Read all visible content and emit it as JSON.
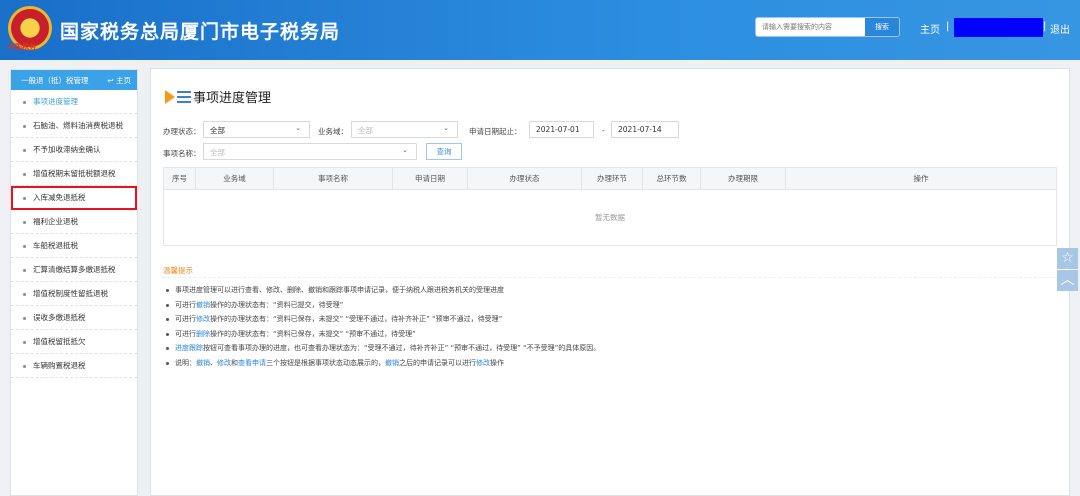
{
  "header": {
    "title": "国家税务总局厦门市电子税务局",
    "emblem_text": "中国税务",
    "search_placeholder": "请输入需要搜索的内容",
    "search_button": "搜索",
    "home": "主页",
    "separator": "|",
    "logout": "退出"
  },
  "sidebar": {
    "title": "一般退（抵）税管理",
    "home": "主页",
    "items": [
      "事项进度管理",
      "石脑油、燃料油消费税退税",
      "不予加收滞纳金确认",
      "增值税期末留抵税额退税",
      "入库减免退抵税",
      "福利企业退税",
      "车船税退抵税",
      "汇算清缴结算多缴退抵税",
      "增值税制度性留抵退税",
      "误收多缴退抵税",
      "增值税留抵抵欠",
      "车辆购置税退税"
    ]
  },
  "main": {
    "title": "事项进度管理",
    "filters": {
      "status_label": "办理状态：",
      "status_value": "全部",
      "domain_label": "业务域：",
      "domain_placeholder": "全部",
      "date_label": "申请日期起止：",
      "date_from": "2021-07-01",
      "date_sep": "-",
      "date_to": "2021-07-14",
      "item_label": "事项名称：",
      "item_placeholder": "全部",
      "query": "查询"
    },
    "table": {
      "headers": [
        "序号",
        "业务域",
        "事项名称",
        "申请日期",
        "办理状态",
        "办理环节",
        "总环节数",
        "办理期限",
        "操作"
      ],
      "empty": "暂无数据"
    },
    "tips": {
      "title": "温馨提示",
      "lines": [
        [
          [
            "事项进度管理可以进行查看、修改、删除、撤销和跟踪事项申请记录，便于纳税人跟进税务机关的受理进度",
            0
          ]
        ],
        [
          [
            "可进行",
            0
          ],
          [
            "撤销",
            1
          ],
          [
            "操作的办理状态有：“资料已提交，待受理”",
            0
          ]
        ],
        [
          [
            "可进行",
            0
          ],
          [
            "修改",
            1
          ],
          [
            "操作的办理状态有：“资料已保存，未提交”  “受理不通过，待补齐补正”  “预审不通过，待受理”",
            0
          ]
        ],
        [
          [
            "可进行",
            0
          ],
          [
            "删除",
            1
          ],
          [
            "操作的办理状态有：“资料已保存，未提交”  “预审不通过，待受理”",
            0
          ]
        ],
        [
          [
            "进度跟踪",
            1
          ],
          [
            "按钮可查看事项办理的进度，也可查看办理状态为：“受理不通过，待补齐补正”  “预审不通过，待受理”  “不予受理”的具体原因。",
            0
          ]
        ],
        [
          [
            "说明：",
            0
          ],
          [
            "撤销",
            1
          ],
          [
            "、",
            0
          ],
          [
            "修改",
            1
          ],
          [
            "和",
            0
          ],
          [
            "查看申请",
            1
          ],
          [
            "三个按钮是根据事项状态动态展示的，",
            0
          ],
          [
            "撤销",
            1
          ],
          [
            "之后的申请记录可以进行",
            0
          ],
          [
            "修改",
            1
          ],
          [
            "操作",
            0
          ]
        ]
      ]
    }
  },
  "float": {
    "star": "☆",
    "up": "︿"
  }
}
